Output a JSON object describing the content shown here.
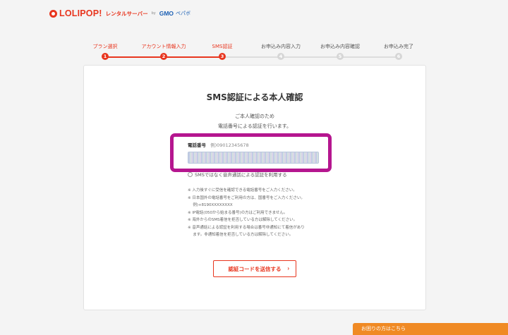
{
  "brand": {
    "name": "LOLIPOP!",
    "sub": "レンタルサーバー",
    "by": "by",
    "gmo": "GMO",
    "pepabo": "ペパボ"
  },
  "steps": [
    {
      "num": "1",
      "label": "プラン選択",
      "state": "done"
    },
    {
      "num": "2",
      "label": "アカウント情報入力",
      "state": "done"
    },
    {
      "num": "3",
      "label": "SMS認証",
      "state": "current"
    },
    {
      "num": "4",
      "label": "お申込み内容入力",
      "state": "todo"
    },
    {
      "num": "5",
      "label": "お申込み内容確認",
      "state": "todo"
    },
    {
      "num": "6",
      "label": "お申込み完了",
      "state": "todo"
    }
  ],
  "card": {
    "title": "SMS認証による本人確認",
    "lead_line1": "ご本人確認のため",
    "lead_line2": "電話番号による認証を行います。",
    "phone_label": "電話番号",
    "phone_hint": "例)09012345678",
    "phone_value": "",
    "voice_option": "SMSではなく音声通話による認証を利用する",
    "notes": [
      "※ 入力後すぐに受信を確認できる電話番号をご入力ください。",
      "※ 日本国外の電話番号をご利用の方は、国番号をご入力ください。",
      "　 例)+8190XXXXXXXX",
      "※ IP電話(050から始まる番号)の方はご利用できません。",
      "※ 海外からのSMS着信を拒否している方は解除してください。",
      "※ 音声通話による認証を利用する場合は番号非通知にて着信があり",
      "　 ます。非通知着信を拒否している方は解除してください。"
    ],
    "send_label": "認証コードを送信する",
    "send_chevron": "›"
  },
  "help_label": "お困りの方はこちら",
  "colors": {
    "brand_red": "#e8351e",
    "highlight_magenta": "#b5168f",
    "help_orange": "#f08a24"
  }
}
